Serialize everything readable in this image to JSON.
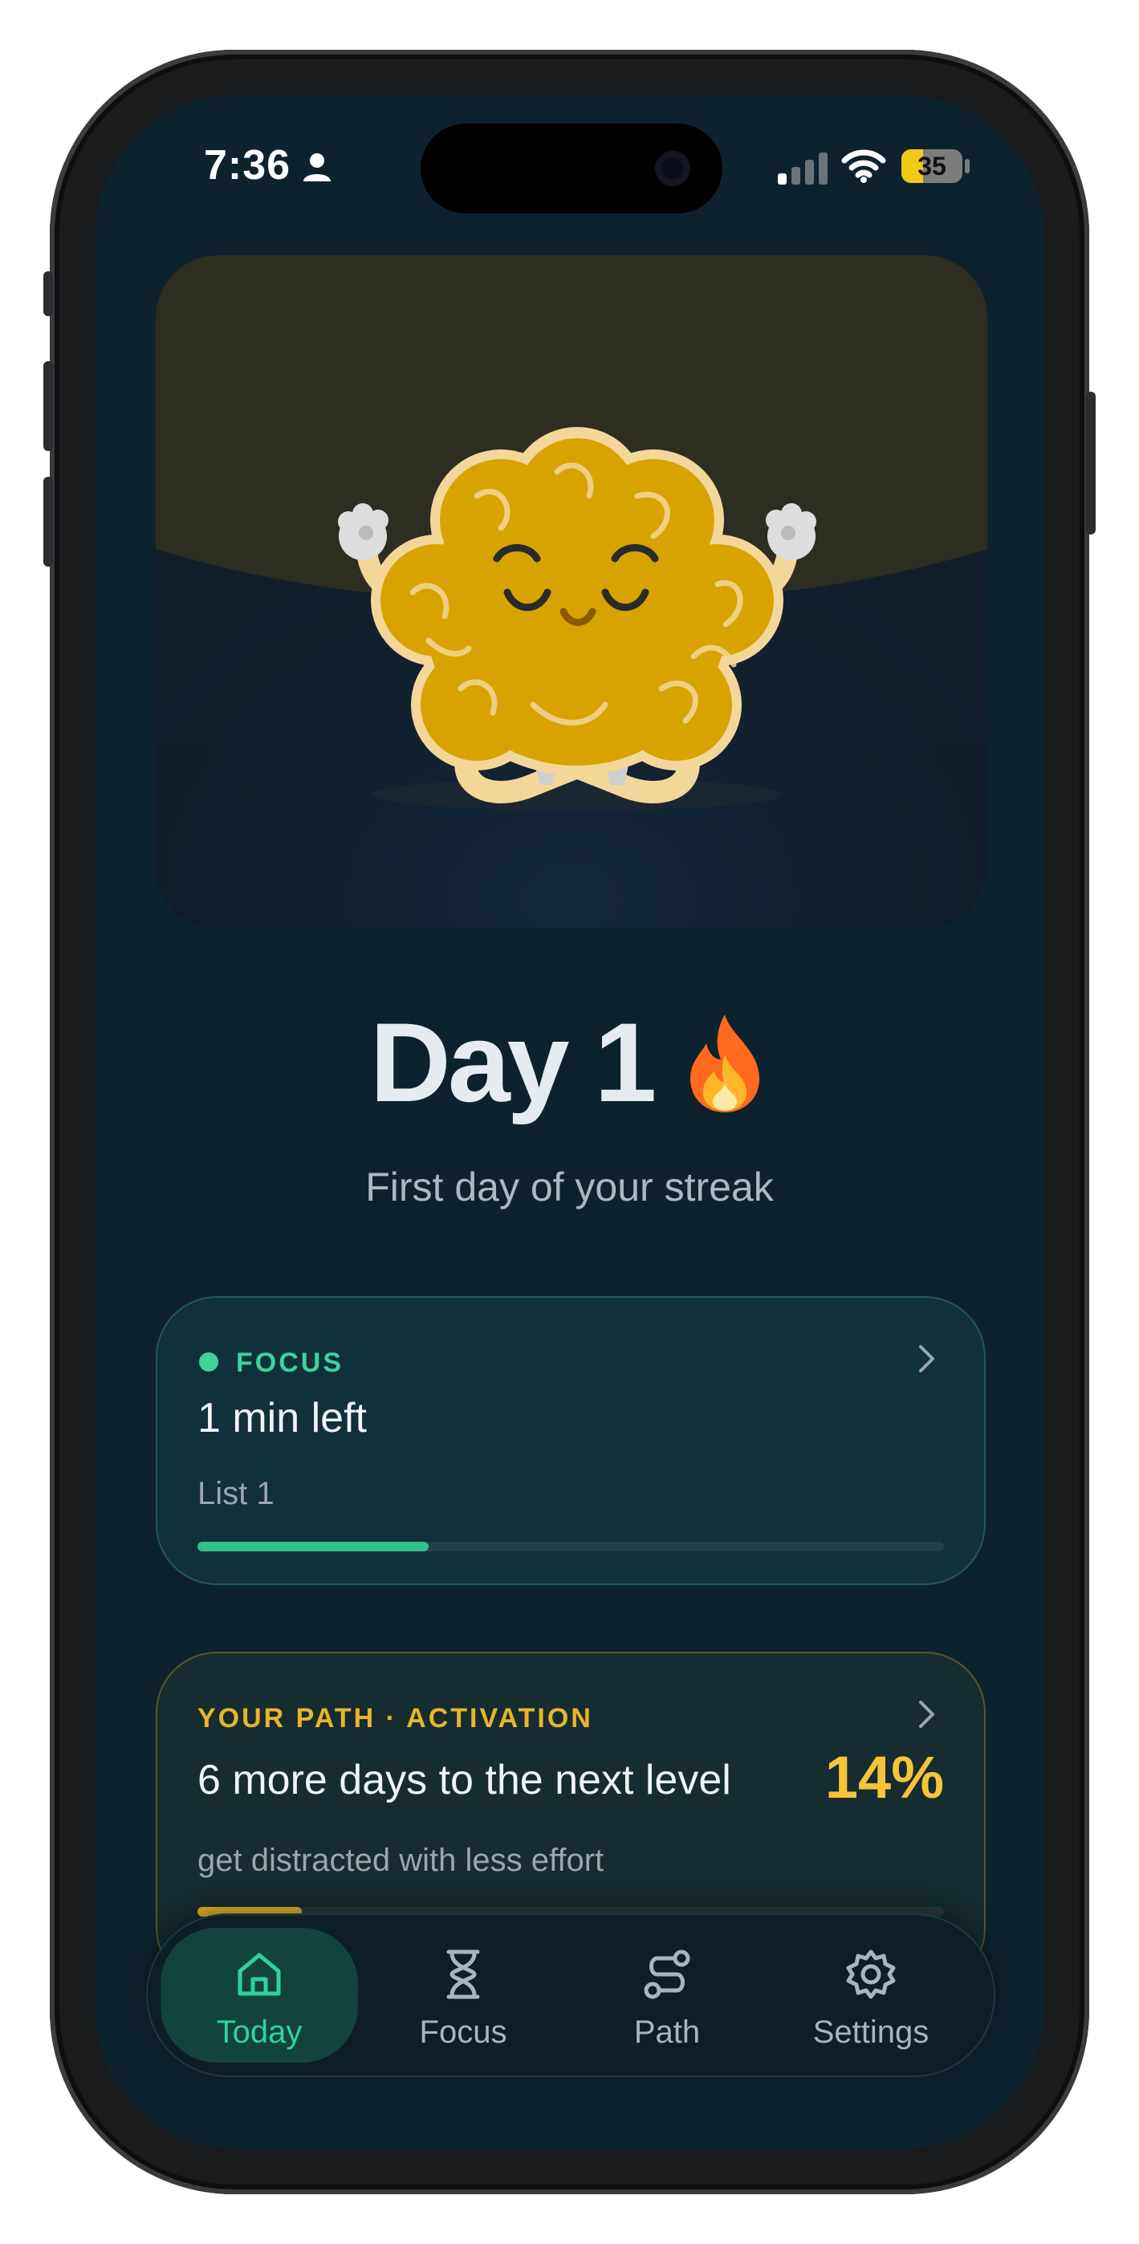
{
  "status_bar": {
    "time": "7:36",
    "battery": "35",
    "icons": [
      "person-icon",
      "signal-icon",
      "wifi-icon",
      "battery-icon"
    ]
  },
  "hero": {
    "illustration": "meditating-brain-mascot",
    "colors": {
      "brain": "#d8a300",
      "brain_outline": "#f3d79a",
      "night_sky": "#0f1a24",
      "dusk_band": "#2e2d22"
    }
  },
  "day": {
    "title": "Day 1",
    "icon": "fire-emoji",
    "subtitle": "First day of your streak"
  },
  "focus_card": {
    "label": "FOCUS",
    "status": "1 min left",
    "list": "List 1",
    "progress_fraction": 0.31,
    "accent": "#3dd49b"
  },
  "path_card": {
    "label": "YOUR PATH · ACTIVATION",
    "headline": "6 more days to the next level",
    "percent": "14%",
    "description": "get distracted with less effort",
    "progress_fraction": 0.14,
    "accent": "#e8b52a"
  },
  "tabbar": {
    "tabs": [
      {
        "label": "Today",
        "icon": "home-icon",
        "active": true
      },
      {
        "label": "Focus",
        "icon": "hourglass-icon",
        "active": false
      },
      {
        "label": "Path",
        "icon": "path-icon",
        "active": false
      },
      {
        "label": "Settings",
        "icon": "gear-icon",
        "active": false
      }
    ]
  }
}
